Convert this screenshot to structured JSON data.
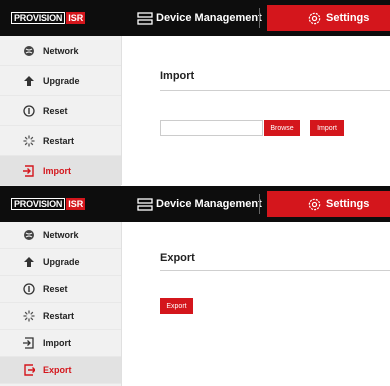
{
  "brand": {
    "logo_text": "PROVISION",
    "logo_suffix": "ISR"
  },
  "topnav": {
    "device_management": "Device Management",
    "settings": "Settings"
  },
  "colors": {
    "accent": "#d4161c",
    "topbar": "#0d0d0d",
    "sidebar": "#f1f1f1"
  },
  "panel_import": {
    "sidebar": [
      {
        "label": "Network",
        "icon": "globe-icon"
      },
      {
        "label": "Upgrade",
        "icon": "arrow-up-icon"
      },
      {
        "label": "Reset",
        "icon": "reset-icon"
      },
      {
        "label": "Restart",
        "icon": "spinner-icon"
      },
      {
        "label": "Import",
        "icon": "import-icon",
        "active": true
      }
    ],
    "title": "Import",
    "file_value": "",
    "browse_label": "Browse",
    "import_label": "Import"
  },
  "panel_export": {
    "sidebar": [
      {
        "label": "Network",
        "icon": "globe-icon"
      },
      {
        "label": "Upgrade",
        "icon": "arrow-up-icon"
      },
      {
        "label": "Reset",
        "icon": "reset-icon"
      },
      {
        "label": "Restart",
        "icon": "spinner-icon"
      },
      {
        "label": "Import",
        "icon": "import-icon"
      },
      {
        "label": "Export",
        "icon": "export-icon",
        "active": true
      }
    ],
    "title": "Export",
    "export_label": "Export"
  }
}
